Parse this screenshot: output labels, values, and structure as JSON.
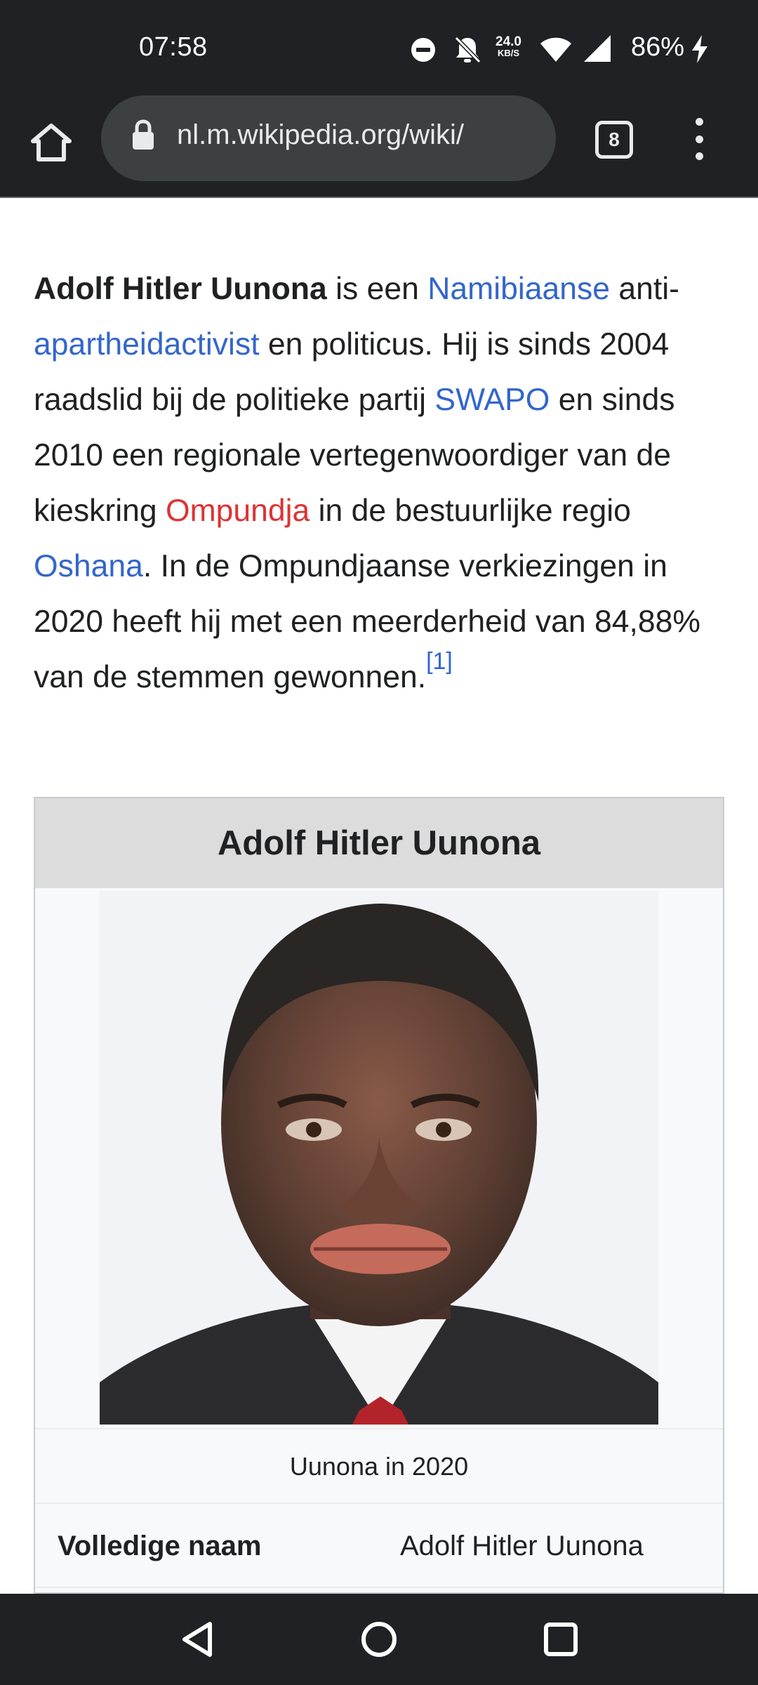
{
  "status_bar": {
    "time": "07:58",
    "net_speed": "24.0",
    "net_speed_unit": "KB/S",
    "battery": "86%",
    "icons": [
      "do-not-disturb-icon",
      "notifications-off-icon",
      "wifi-icon",
      "cell-signal-icon",
      "charging-bolt-icon"
    ]
  },
  "browser": {
    "url": "nl.m.wikipedia.org/wiki/",
    "tab_count": "8"
  },
  "article": {
    "intro": [
      {
        "text": "Adolf Hitler Uunona",
        "style": "bold"
      },
      {
        "text": " is een ",
        "style": "plain"
      },
      {
        "text": "Namibiaanse",
        "style": "link"
      },
      {
        "text": " anti-",
        "style": "plain"
      },
      {
        "text": "apartheidactivist",
        "style": "link"
      },
      {
        "text": " en politicus. Hij is sinds 2004 raadslid bij de politieke partij ",
        "style": "plain"
      },
      {
        "text": "SWAPO",
        "style": "link"
      },
      {
        "text": " en sinds 2010 een regionale vertegenwoordiger van de kieskring ",
        "style": "plain"
      },
      {
        "text": "Ompundja",
        "style": "redlink"
      },
      {
        "text": " in de bestuurlijke regio ",
        "style": "plain"
      },
      {
        "text": "Oshana",
        "style": "link"
      },
      {
        "text": ". In de Ompundjaanse verkiezingen in 2020 heeft hij met een meerderheid van 84,88% van de stemmen gewonnen.",
        "style": "plain"
      },
      {
        "text": "[1]",
        "style": "ref"
      }
    ]
  },
  "infobox": {
    "title": "Adolf Hitler Uunona",
    "caption": "Uunona in 2020",
    "rows": [
      {
        "label": "Volledige naam",
        "value": "Adolf Hitler Uunona"
      }
    ]
  },
  "nav_bar": {
    "buttons": [
      "back-icon",
      "home-circle-icon",
      "recents-square-icon"
    ]
  },
  "colors": {
    "link": "#3366cc",
    "redlink": "#dd3333",
    "chrome_dark": "#202124",
    "omnibox": "#3c4043"
  }
}
